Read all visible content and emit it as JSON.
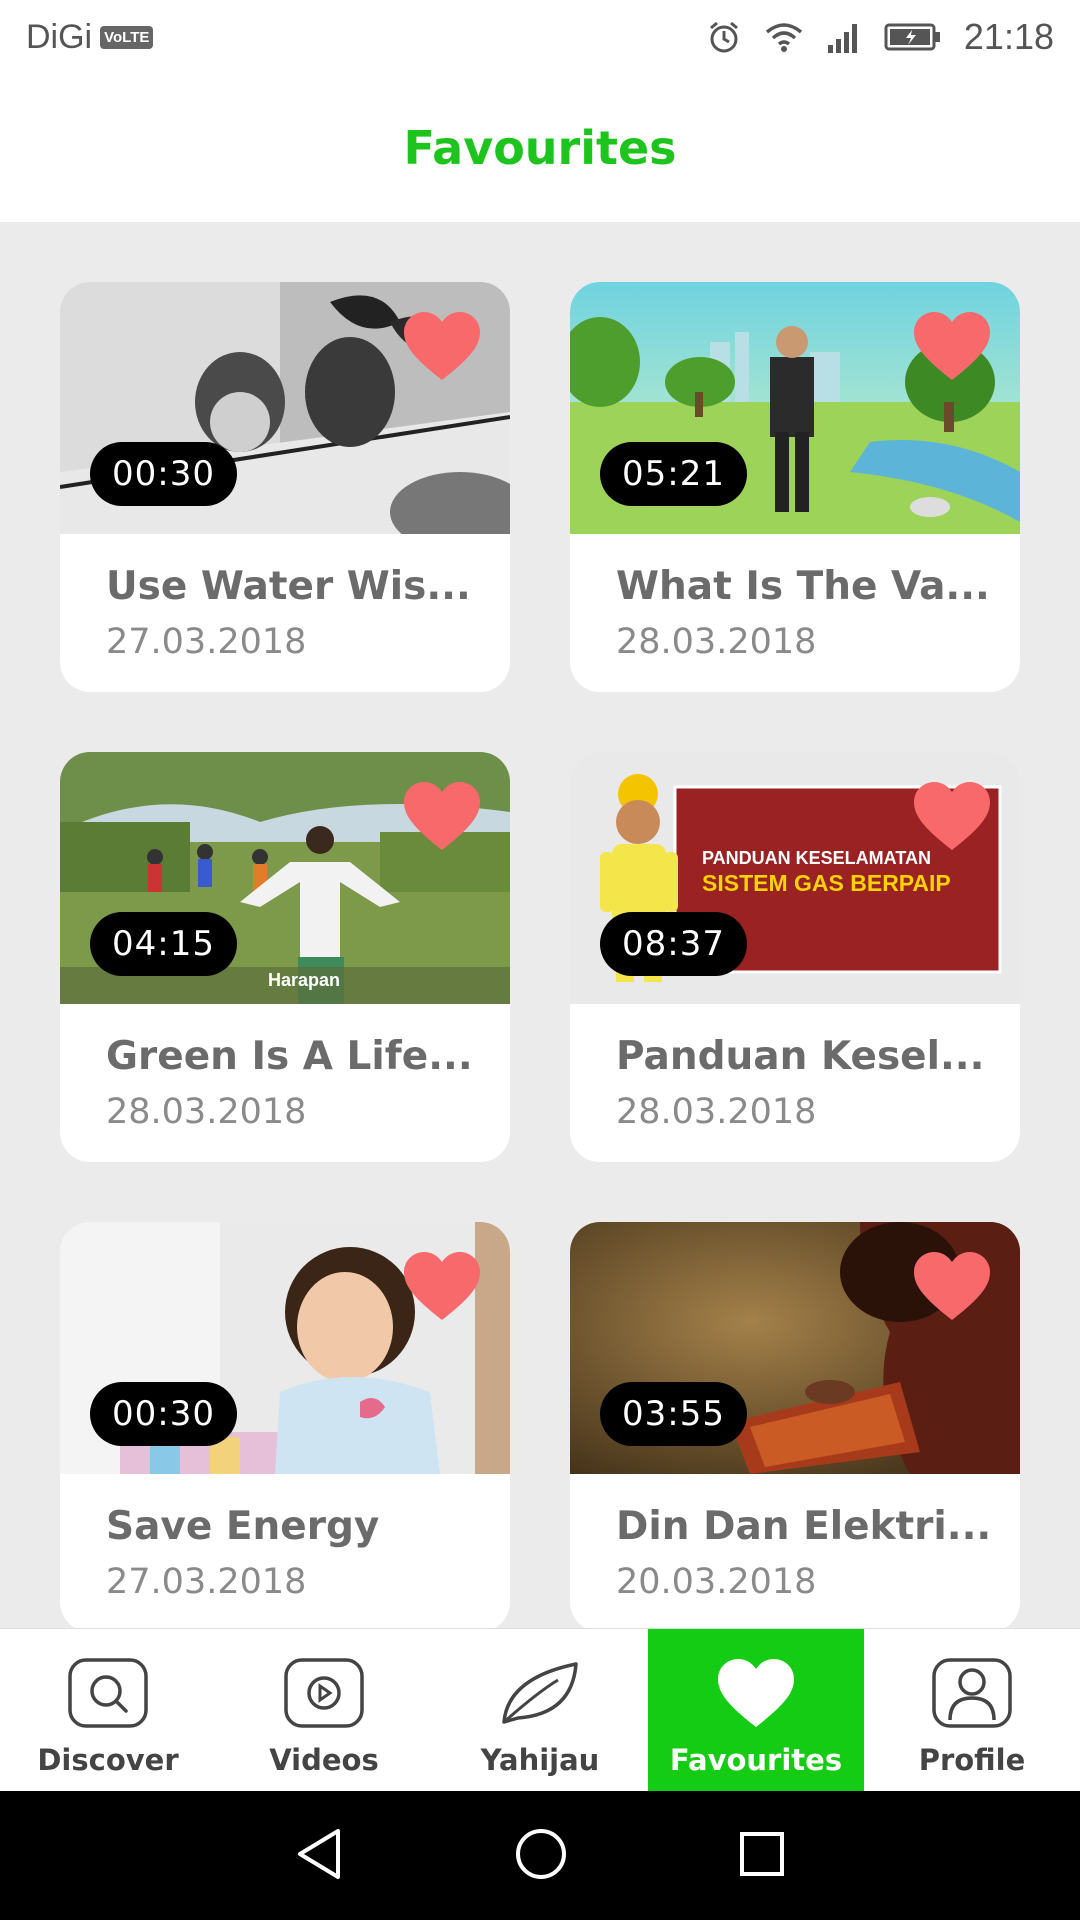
{
  "status_bar": {
    "carrier": "DiGi",
    "network_badge": "VoLTE",
    "time": "21:18",
    "icons": [
      "alarm-icon",
      "wifi-icon",
      "signal-icon",
      "battery-icon"
    ]
  },
  "header": {
    "title": "Favourites"
  },
  "accent_color": "#14cc14",
  "heart_color": "#f8696b",
  "videos": [
    {
      "title": "Use Water Wis...",
      "date": "27.03.2018",
      "duration": "00:30"
    },
    {
      "title": "What Is The Va...",
      "date": "28.03.2018",
      "duration": "05:21"
    },
    {
      "title": "Green Is A Life...",
      "date": "28.03.2018",
      "duration": "04:15",
      "caption": "Harapan"
    },
    {
      "title": "Panduan Kesel...",
      "date": "28.03.2018",
      "duration": "08:37",
      "banner_line1": "PANDUAN KESELAMATAN",
      "banner_line2": "SISTEM GAS BERPAIP"
    },
    {
      "title": "Save Energy",
      "date": "27.03.2018",
      "duration": "00:30"
    },
    {
      "title": "Din Dan Elektri...",
      "date": "20.03.2018",
      "duration": "03:55"
    }
  ],
  "nav": {
    "items": [
      {
        "label": "Discover",
        "icon": "search-icon"
      },
      {
        "label": "Videos",
        "icon": "play-icon"
      },
      {
        "label": "Yahijau",
        "icon": "leaf-icon"
      },
      {
        "label": "Favourites",
        "icon": "heart-icon",
        "active": true
      },
      {
        "label": "Profile",
        "icon": "user-icon"
      }
    ]
  }
}
